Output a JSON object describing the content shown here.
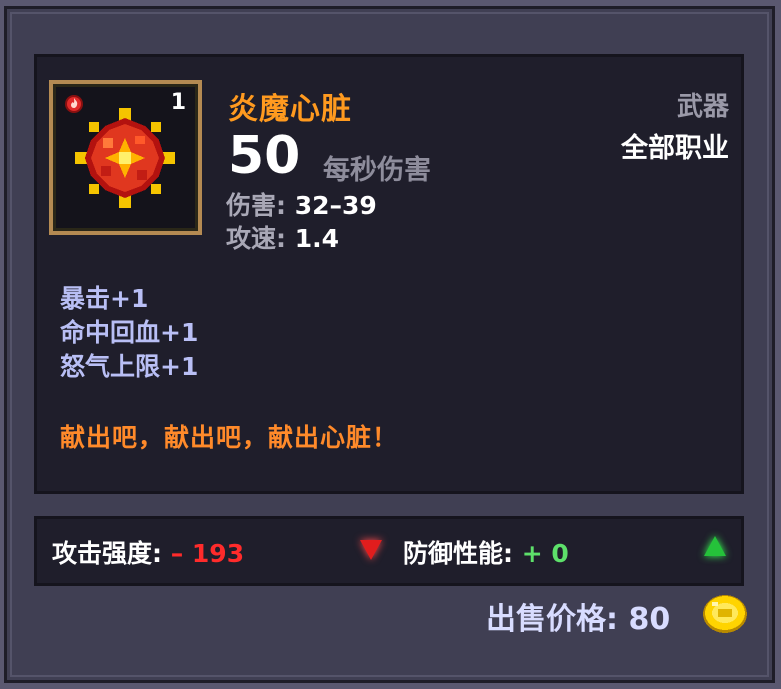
{
  "item": {
    "name": "炎魔心脏",
    "quantity": "1",
    "type": "武器",
    "class_requirement": "全部职业",
    "dps_value": "50",
    "dps_label": "每秒伤害",
    "damage_label": "伤害:",
    "damage_value": " 32–39",
    "speed_label": "攻速:",
    "speed_value": " 1.4",
    "bonuses": [
      "暴击+1",
      "命中回血+1",
      "怒气上限+1"
    ],
    "flavor_text": "献出吧，献出吧，献出心脏！",
    "icon": "fire-gem-icon",
    "rarity_icon": "fire-element-icon"
  },
  "comparison": {
    "attack_label": "攻击强度:",
    "attack_delta": " – 193",
    "attack_trend_icon": "arrow-down-icon",
    "defense_label": "防御性能:",
    "defense_delta": " + 0",
    "defense_trend_icon": "arrow-up-icon"
  },
  "sell": {
    "label": "出售价格:",
    "value": " 80",
    "icon": "gold-coin-icon"
  },
  "colors": {
    "name": "#ff9a1f",
    "flavor": "#ff8a2a",
    "bonus": "#b9bff5",
    "negative": "#ff2b2b",
    "positive": "#5de06a"
  }
}
